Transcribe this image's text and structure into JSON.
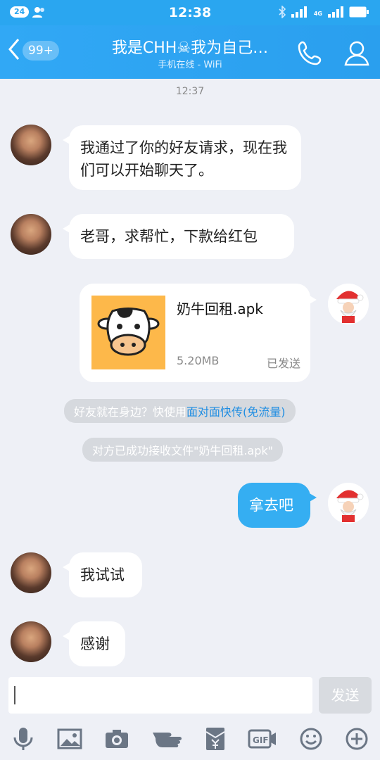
{
  "status_bar": {
    "notification_count": "24",
    "time": "12:38",
    "network_label": "4G"
  },
  "header": {
    "back_count": "99+",
    "title": "我是CHH☠我为自己…",
    "subtitle": "手机在线 - WiFi"
  },
  "timestamp": "12:37",
  "messages": [
    {
      "sender": "friend",
      "text": "我通过了你的好友请求，现在我们可以开始聊天了。"
    },
    {
      "sender": "friend",
      "text": "老哥，求帮忙，下款给红包"
    },
    {
      "sender": "me",
      "type": "file",
      "file_name": "奶牛回租.apk",
      "file_size": "5.20MB",
      "file_status": "已发送"
    },
    {
      "sender": "me",
      "text": "拿去吧"
    },
    {
      "sender": "friend",
      "text": "我试试"
    },
    {
      "sender": "friend",
      "text": "感谢"
    }
  ],
  "system_messages": {
    "nearby_prefix": "好友就在身边？快使用",
    "nearby_link": "面对面快传(免流量)",
    "received": "对方已成功接收文件\"奶牛回租.apk\""
  },
  "composer": {
    "input_value": "",
    "send_label": "发送"
  },
  "toolbar_icons": [
    "microphone-icon",
    "image-icon",
    "camera-icon",
    "poke-icon",
    "red-packet-icon",
    "gif-icon",
    "emoji-icon",
    "plus-icon"
  ],
  "colors": {
    "accent": "#2aa6f0",
    "my_bubble": "#35aef2",
    "background": "#eef0f6"
  }
}
